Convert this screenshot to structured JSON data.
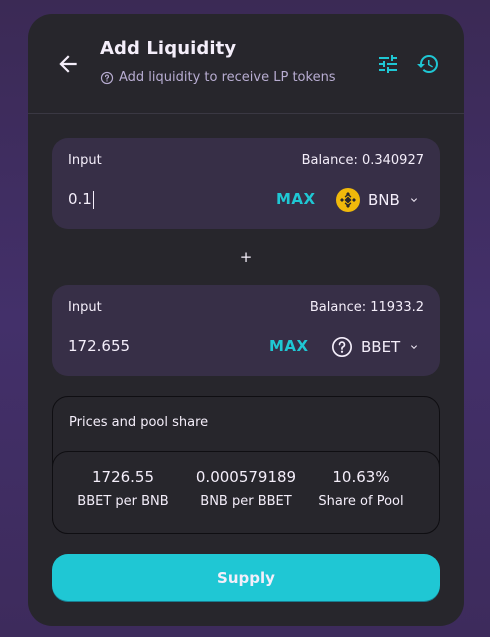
{
  "header": {
    "title": "Add Liquidity",
    "subtitle": "Add liquidity to receive LP tokens"
  },
  "input_a": {
    "label": "Input",
    "balance": "Balance: 0.340927",
    "value": "0.1",
    "max_label": "MAX",
    "token": "BNB",
    "token_icon": "bnb-logo-icon"
  },
  "plus": "+",
  "input_b": {
    "label": "Input",
    "balance": "Balance: 11933.2",
    "value": "172.655",
    "max_label": "MAX",
    "token": "BBET",
    "token_icon": "unknown-token-icon"
  },
  "prices": {
    "title": "Prices and pool share",
    "stats": [
      {
        "value": "1726.55",
        "label": "BBET per BNB"
      },
      {
        "value": "0.000579189",
        "label": "BNB per BBET"
      },
      {
        "value": "10.63%",
        "label": "Share of Pool"
      }
    ]
  },
  "supply_label": "Supply",
  "colors": {
    "accent": "#1fc7d4",
    "card": "#27262c",
    "panel": "#372f47",
    "bnb": "#f0b90b"
  }
}
